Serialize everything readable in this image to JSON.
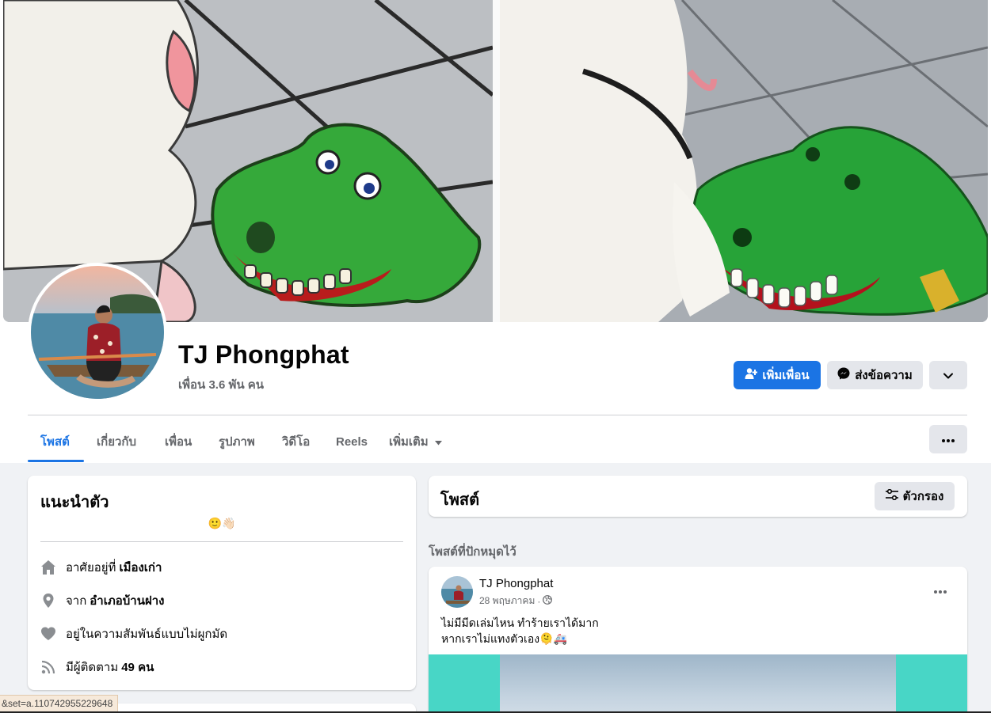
{
  "profile": {
    "name": "TJ Phongphat",
    "friend_count": "เพื่อน 3.6 พัน คน"
  },
  "actions": {
    "add_friend": "เพิ่มเพื่อน",
    "message": "ส่งข้อความ"
  },
  "tabs": [
    {
      "label": "โพสต์",
      "active": true
    },
    {
      "label": "เกี่ยวกับ",
      "active": false
    },
    {
      "label": "เพื่อน",
      "active": false
    },
    {
      "label": "รูปภาพ",
      "active": false
    },
    {
      "label": "วิดีโอ",
      "active": false
    },
    {
      "label": "Reels",
      "active": false
    },
    {
      "label": "เพิ่มเติม",
      "active": false
    }
  ],
  "intro": {
    "title": "แนะนำตัว",
    "bio_emoji": "🙂👋🏻",
    "lives_prefix": "อาศัยอยู่ที่",
    "lives_value": "เมืองเก่า",
    "from_prefix": "จาก",
    "from_value": "อำเภอบ้านฝาง",
    "relationship": "อยู่ในความสัมพันธ์แบบไม่ผูกมัด",
    "followers_prefix": "มีผู้ติดตาม",
    "followers_value": "49 คน"
  },
  "posts_section": {
    "title": "โพสต์",
    "filter_label": "ตัวกรอง",
    "pinned_label": "โพสต์ที่ปักหมุดไว้"
  },
  "pinned_post": {
    "author": "TJ Phongphat",
    "date": "28 พฤษภาคม",
    "line1": "ไม่มีมีดเล่มไหน ทำร้ายเราได้มาก",
    "line2": "หากเราไม่แทงตัวเอง🫠🚑"
  },
  "status_url": "&set=a.110742955229648",
  "colors": {
    "accent": "#1b74e4",
    "secondary_button": "#e4e6eb",
    "page_bg": "#f0f2f5",
    "muted_text": "#65676b"
  }
}
